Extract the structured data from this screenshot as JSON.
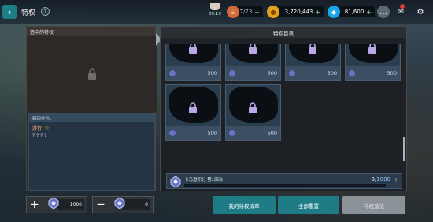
{
  "header": {
    "title": "特权",
    "help": "?",
    "timer": "09:19",
    "resources": [
      {
        "name": "stamina",
        "value": "57",
        "max": "/73",
        "color": "#d26a3a",
        "icon": "stamina-icon"
      },
      {
        "name": "gold",
        "value": "3,720,443",
        "color": "#e3a21a",
        "icon": "coin-icon"
      },
      {
        "name": "gems",
        "value": "81,600",
        "color": "#19a6e8",
        "icon": "diamond-icon"
      }
    ]
  },
  "left_panel": {
    "title": "选中的特权",
    "condition_title": "解锁条件：",
    "condition_text": "游行",
    "condition_value": "? ? ? ?",
    "minus_button": {
      "value": "-1000"
    },
    "second_button": {
      "value": "0"
    }
  },
  "right_panel": {
    "title": "特权目录",
    "cards": [
      {
        "cost": "500"
      },
      {
        "cost": "500"
      },
      {
        "cost": "500"
      },
      {
        "cost": "500"
      },
      {
        "cost": "500"
      },
      {
        "cost": "500"
      }
    ],
    "progress": {
      "label": "卡马逊积分 第1回合",
      "current": "0",
      "max": "/1000",
      "fraction": 0
    }
  },
  "buttons": {
    "my_list": "我的特权清单",
    "reset_all": "全部重置",
    "activate": "特权激活"
  },
  "colors": {
    "teal": "#1e7c86",
    "grey_btn": "#8a9197"
  }
}
